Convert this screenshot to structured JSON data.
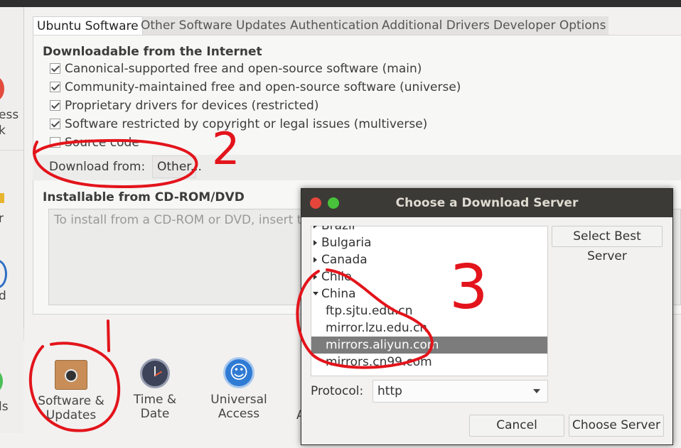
{
  "background": {
    "sidebar_fragments": [
      "ess",
      "k",
      "r",
      "d",
      "ls"
    ],
    "launcher": [
      {
        "label_line1": "Software &",
        "label_line2": "Updates",
        "icon": "software-updates-icon"
      },
      {
        "label_line1": "Time &",
        "label_line2": "Date",
        "icon": "clock-icon"
      },
      {
        "label_line1": "Universal",
        "label_line2": "Access",
        "icon": "accessibility-icon"
      }
    ],
    "partial_label": "A"
  },
  "software_window": {
    "tabs": [
      "Ubuntu Software",
      "Other Software",
      "Updates",
      "Authentication",
      "Additional Drivers",
      "Developer Options"
    ],
    "active_tab": "Ubuntu Software",
    "section_internet": "Downloadable from the Internet",
    "components": [
      {
        "label": "Canonical-supported free and open-source software (main)",
        "checked": true
      },
      {
        "label": "Community-maintained free and open-source software (universe)",
        "checked": true
      },
      {
        "label": "Proprietary drivers for devices (restricted)",
        "checked": true
      },
      {
        "label": "Software restricted by copyright or legal issues (multiverse)",
        "checked": true
      },
      {
        "label": "Source code",
        "checked": false
      }
    ],
    "download_from_label": "Download from:",
    "download_from_value": "Other...",
    "section_cdrom": "Installable from CD-ROM/DVD",
    "cdrom_hint": "To install from a CD-ROM or DVD, insert the"
  },
  "dialog": {
    "title": "Choose a Download Server",
    "tree": [
      {
        "label": "Brazil",
        "kind": "country",
        "expanded": false
      },
      {
        "label": "Bulgaria",
        "kind": "country",
        "expanded": false
      },
      {
        "label": "Canada",
        "kind": "country",
        "expanded": false
      },
      {
        "label": "Chile",
        "kind": "country",
        "expanded": false
      },
      {
        "label": "China",
        "kind": "country",
        "expanded": true
      },
      {
        "label": "ftp.sjtu.edu.cn",
        "kind": "server"
      },
      {
        "label": "mirror.lzu.edu.cn",
        "kind": "server"
      },
      {
        "label": "mirrors.aliyun.com",
        "kind": "server",
        "selected": true
      },
      {
        "label": "mirrors.cn99.com",
        "kind": "server"
      }
    ],
    "select_best_label": "Select Best Server",
    "protocol_label": "Protocol:",
    "protocol_value": "http",
    "cancel_label": "Cancel",
    "choose_label": "Choose Server"
  },
  "annotations": {
    "step1": "1",
    "step2": "2",
    "step3": "3",
    "color": "#e3141b"
  },
  "colors": {
    "dialog_titlebar": "#3b3a36",
    "selection": "#7c7c7c",
    "close_button": "#e5453a",
    "maximize_button": "#47c23a"
  }
}
